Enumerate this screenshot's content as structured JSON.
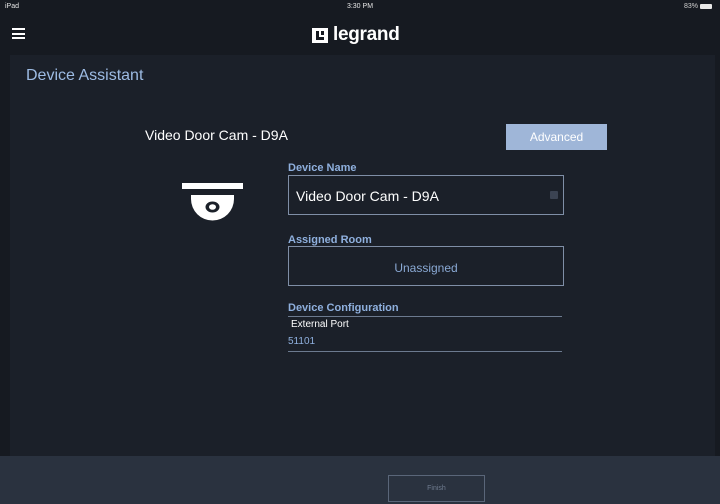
{
  "status_bar": {
    "device": "iPad",
    "time": "3:30 PM",
    "battery": "83%"
  },
  "header": {
    "menu_icon": "hamburger-menu-icon",
    "logo_text": "legrand",
    "logo_icon": "legrand-logo-mark"
  },
  "page": {
    "title": "Device Assistant"
  },
  "device": {
    "label": "Video Door Cam - D9A",
    "icon": "dome-camera-icon",
    "advanced_button": "Advanced"
  },
  "form": {
    "device_name_label": "Device Name",
    "device_name_value": "Video Door Cam - D9A",
    "assigned_room_label": "Assigned Room",
    "assigned_room_value": "Unassigned",
    "device_config_label": "Device Configuration",
    "external_port_label": "External Port",
    "external_port_value": "51101"
  },
  "footer": {
    "finish_button": "Finish"
  },
  "colors": {
    "background": "#161a21",
    "panel": "#1b2029",
    "accent": "#9fb6d8",
    "label_blue": "#8fb0de",
    "footer": "#2a323f"
  }
}
